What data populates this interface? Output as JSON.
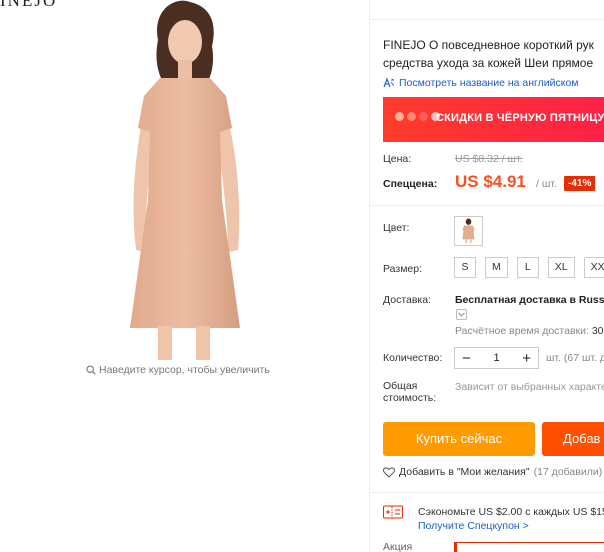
{
  "brand_fragment": "INEJO",
  "zoom_hint": "Наведите курсор, чтобы увеличить",
  "product": {
    "title_line1": "FINEJO О повседневное короткий рук",
    "title_line2": "средства ухода за кожей Шеи прямое",
    "translate_link": "Посмотреть название на английском"
  },
  "promo_banner": {
    "text": "СКИДКИ В ЧЁРНУЮ ПЯТНИЦУ",
    "dot_colors": [
      "#ffb199",
      "#ff8a70",
      "#ff5e5e",
      "#ffc0c0"
    ]
  },
  "price": {
    "label": "Цена:",
    "old": "US $8.32 / шт.",
    "special_label": "Спеццена:",
    "new": "US $4.91",
    "unit": "/ шт.",
    "discount": "-41%"
  },
  "color_label": "Цвет:",
  "size": {
    "label": "Размер:",
    "options": [
      "S",
      "M",
      "L",
      "XL",
      "XXL"
    ]
  },
  "shipping": {
    "label": "Доставка:",
    "main": "Бесплатная доставка в Russia",
    "time_label": "Расчётное время доставки:",
    "time_value": "30-"
  },
  "quantity": {
    "label": "Количество:",
    "minus": "−",
    "value": "1",
    "plus": "+",
    "hint": "шт. (67 шт. д"
  },
  "total": {
    "label_line1": "Общая",
    "label_line2": "стоимость:",
    "value": "Зависит от выбранных характе"
  },
  "buttons": {
    "buy_now": "Купить сейчас",
    "add_to_cart": "Добав"
  },
  "wishlist": {
    "label": "Добавить в \"Мои желания\"",
    "count": "(17 добавили)"
  },
  "coupon": {
    "text": "Сэкономьте US $2.00 с каждых US $15.0",
    "link": "Получите Спецкупон >"
  },
  "promo_label": "Акция",
  "colors": {
    "accent_orange": "#ff9a00",
    "cart_orange": "#ff4f00",
    "price_red": "#ff4d1f",
    "link_blue": "#1a5ccf"
  }
}
